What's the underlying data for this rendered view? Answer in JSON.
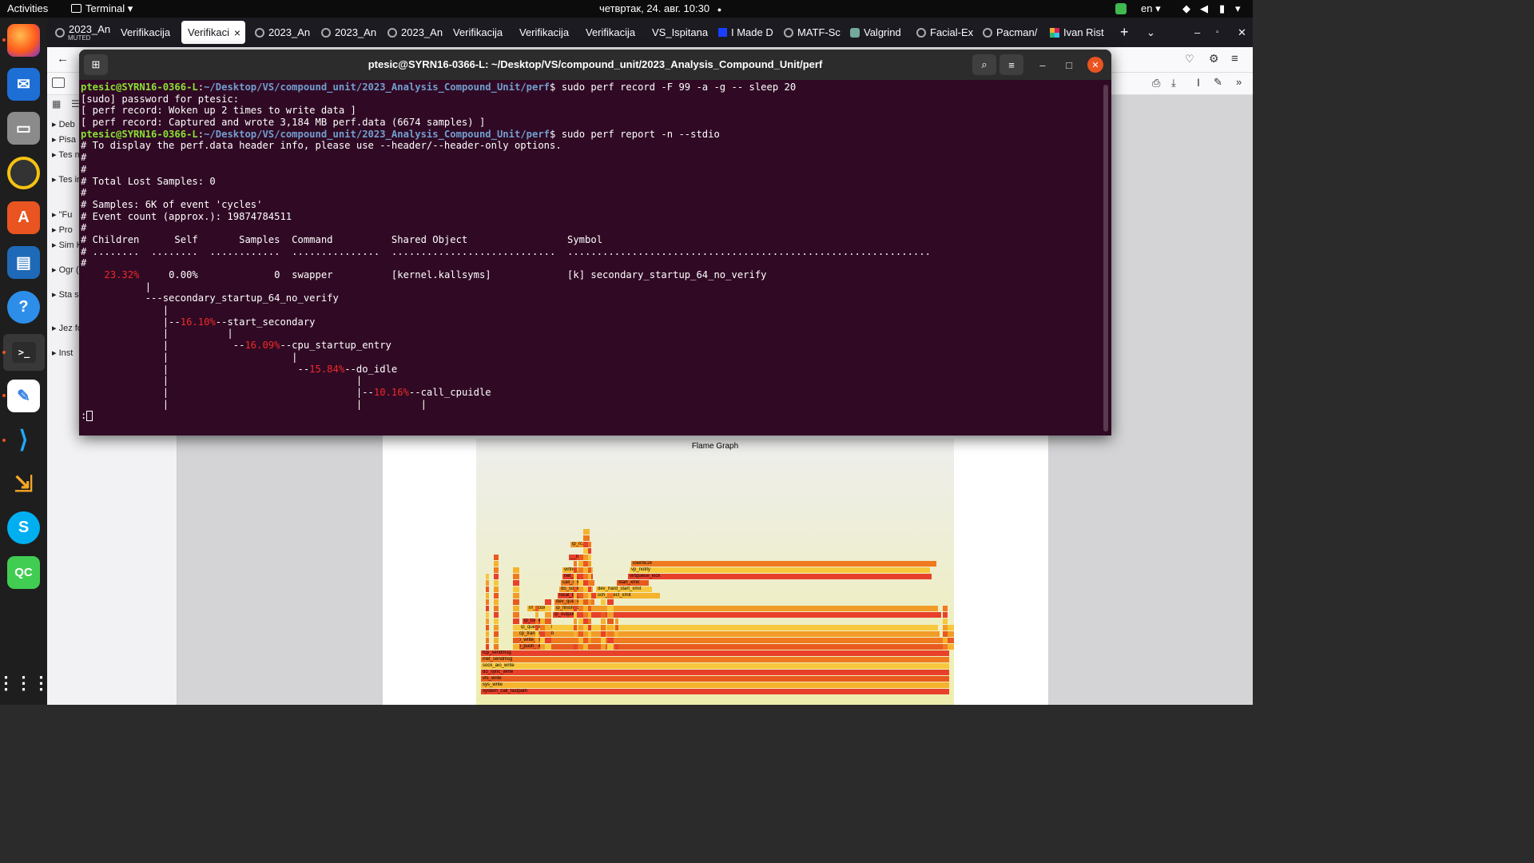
{
  "topbar": {
    "activities": "Activities",
    "app": "Terminal",
    "datetime": "четвртак, 24. авг. 10:30",
    "lang": "en"
  },
  "dock": {
    "apps": [
      "Firefox",
      "Thunderbird",
      "Files",
      "Rhythmbox",
      "Ubuntu Software",
      "LibreOffice Writer",
      "Help",
      "Terminal",
      "Text Editor",
      "Visual Studio Code",
      "Migration",
      "Skype",
      "QC"
    ]
  },
  "browser": {
    "tabs": [
      {
        "label": "2023_An",
        "muted": "MUTED"
      },
      {
        "label": "Verifikacija"
      },
      {
        "label": "Verifikaci"
      },
      {
        "label": "2023_An"
      },
      {
        "label": "2023_An"
      },
      {
        "label": "2023_An"
      },
      {
        "label": "Verifikacija"
      },
      {
        "label": "Verifikacija"
      },
      {
        "label": "Verifikacija"
      },
      {
        "label": "VS_Ispitana"
      },
      {
        "label": "I Made D"
      },
      {
        "label": "MATF-Sc"
      },
      {
        "label": "Valgrind"
      },
      {
        "label": "Facial-Ex"
      },
      {
        "label": "Pacman/"
      },
      {
        "label": "Ivan Rist"
      }
    ],
    "sidebar": [
      "Deb",
      "Pisa",
      "Tes met",
      "Tes imit test",
      "\"Fu",
      "Pro",
      "Sim KLE",
      "Ogr (ala",
      "Sta sta alat",
      "Jez forr",
      "Inst"
    ]
  },
  "flame": {
    "title": "Flame Graph",
    "frames": [
      "tcp_sendmsg",
      "inet_sendmsg",
      "sock_aio_write",
      "do_sync_write",
      "vfs_write",
      "sys_write",
      "system_call_fastpath",
      "tcp_push_one",
      "tcp_write_xmit",
      "tcp_transmit_skb",
      "ip_queue_xmit",
      "ip_local_out",
      "ip_output",
      "ip_finish_output",
      "dev_queue_xmit",
      "nf_hook_...",
      "local_bh_en...",
      "do_softirq",
      "call_softi...",
      "dev_hard_start_xmit",
      "sch_direct_xmit",
      "start_xmit",
      "virtqueue_kick",
      "vp_notify",
      "iowrite16",
      "net_rx_acti...",
      "virtnet_po...",
      "ip_rc...",
      "__netif..."
    ]
  },
  "terminal": {
    "title": "ptesic@SYRN16-0366-L: ~/Desktop/VS/compound_unit/2023_Analysis_Compound_Unit/perf",
    "user": "ptesic@SYRN16-0366-L",
    "path": "~/Desktop/VS/compound_unit/2023_Analysis_Compound_Unit/perf",
    "cmd1": " sudo perf record -F 99 -a -g -- sleep 20",
    "l_sudo": "[sudo] password for ptesic:",
    "l_woken": "[ perf record: Woken up 2 times to write data ]",
    "l_captured": "[ perf record: Captured and wrote 3,184 MB perf.data (6674 samples) ]",
    "cmd2": " sudo perf report -n --stdio",
    "l_header": "# To display the perf.data header info, please use --header/--header-only options.",
    "l_hash": "#",
    "l_lost": "# Total Lost Samples: 0",
    "l_samples": "# Samples: 6K of event 'cycles'",
    "l_count": "# Event count (approx.): 19874784511",
    "l_cols": "# Children      Self       Samples  Command          Shared Object                 Symbol",
    "l_dots": "# ........  ........  ............  ...............  ............................  ..............................................................",
    "row": {
      "children": "23.32%",
      "rest": "     0.00%             0  swapper          [kernel.kallsyms]             [k] secondary_startup_64_no_verify"
    },
    "tree": {
      "pipe0": "           |",
      "root": "           ---secondary_startup_64_no_verify",
      "pipe1": "              |",
      "a_pre": "              |--",
      "a_pct": "16.10%",
      "a_sym": "--start_secondary",
      "pipe2": "              |          |",
      "b_pre": "              |           --",
      "b_pct": "16.09%",
      "b_sym": "--cpu_startup_entry",
      "pipe3": "              |                     |",
      "c_pre": "              |                      --",
      "c_pct": "15.84%",
      "c_sym": "--do_idle",
      "pipe4": "              |                                |",
      "d_pre": "              |                                |--",
      "d_pct": "10.16%",
      "d_sym": "--call_cpuidle",
      "pipe5": "              |                                |          |"
    },
    "prompt_end": ":"
  },
  "colors": {
    "terminal_bg": "#300a24",
    "prompt_user": "#8ae234",
    "prompt_path": "#729fcf",
    "percent": "#ef2929",
    "close": "#e95420"
  }
}
